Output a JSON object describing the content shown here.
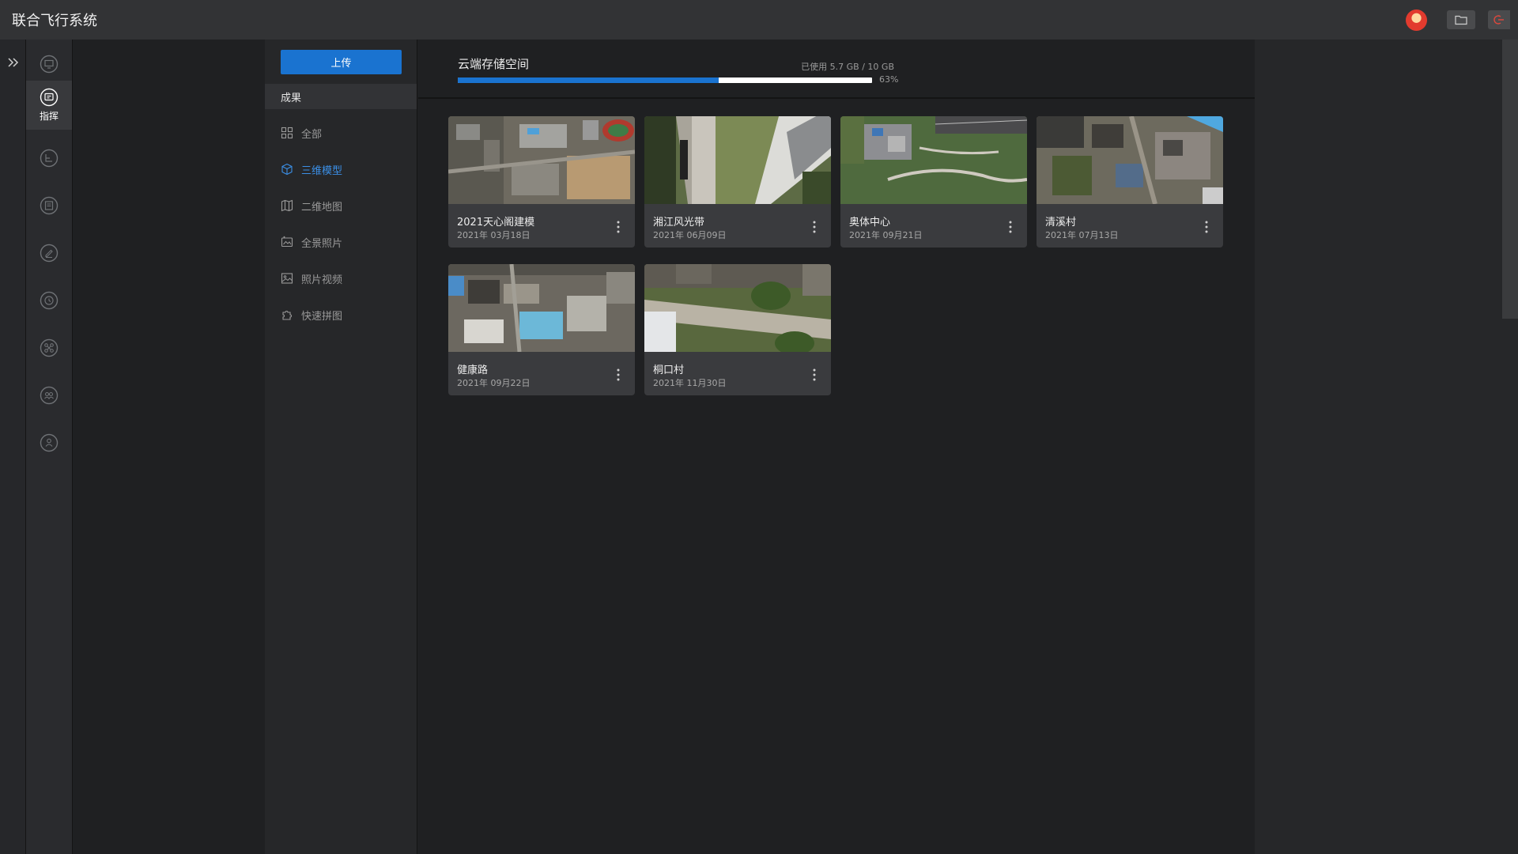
{
  "app": {
    "title": "联合飞行系统"
  },
  "rail": {
    "items": [
      {
        "name": "dashboard"
      },
      {
        "name": "command",
        "label": "指挥",
        "active": true
      },
      {
        "name": "route"
      },
      {
        "name": "media"
      },
      {
        "name": "edit"
      },
      {
        "name": "history"
      },
      {
        "name": "device"
      },
      {
        "name": "team"
      },
      {
        "name": "account"
      }
    ]
  },
  "nav": {
    "upload_label": "上传",
    "section_title": "成果",
    "items": [
      {
        "label": "全部",
        "icon": "grid-icon"
      },
      {
        "label": "三维模型",
        "icon": "cube-icon",
        "active": true
      },
      {
        "label": "二维地图",
        "icon": "map-icon"
      },
      {
        "label": "全景照片",
        "icon": "panorama-icon"
      },
      {
        "label": "照片视频",
        "icon": "image-icon"
      },
      {
        "label": "快速拼图",
        "icon": "puzzle-icon"
      }
    ]
  },
  "storage": {
    "title": "云端存储空间",
    "used_text": "已使用 5.7 GB / 10 GB",
    "percent_text": "63%",
    "percent": 63
  },
  "cards": [
    {
      "name": "2021天心阁建模",
      "date": "2021年 03月18日"
    },
    {
      "name": "湘江风光带",
      "date": "2021年 06月09日"
    },
    {
      "name": "奥体中心",
      "date": "2021年 09月21日"
    },
    {
      "name": "清溪村",
      "date": "2021年 07月13日"
    },
    {
      "name": "健康路",
      "date": "2021年 09月22日"
    },
    {
      "name": "桐口村",
      "date": "2021年 11月30日"
    }
  ]
}
